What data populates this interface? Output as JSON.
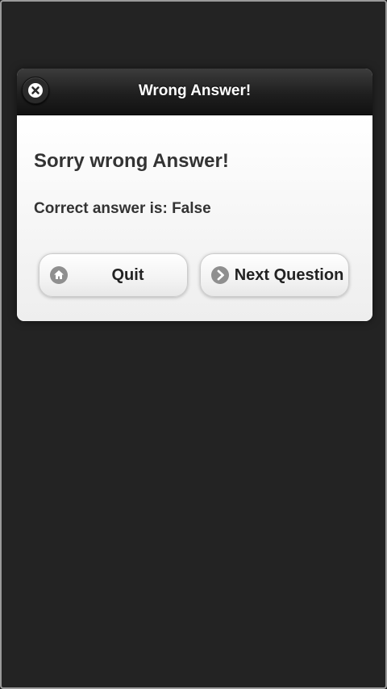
{
  "dialog": {
    "title": "Wrong Answer!",
    "close_icon": "close-icon",
    "heading": "Sorry wrong Answer!",
    "answer_text": "Correct answer is: False",
    "buttons": {
      "quit": {
        "label": "Quit",
        "icon": "home-icon"
      },
      "next": {
        "label": "Next Question",
        "icon": "arrow-right-icon"
      }
    }
  },
  "colors": {
    "background": "#232323",
    "header": "#1f1f1f",
    "content": "#f8f8f8",
    "text": "#333333",
    "icon": "#8f8f8f"
  }
}
